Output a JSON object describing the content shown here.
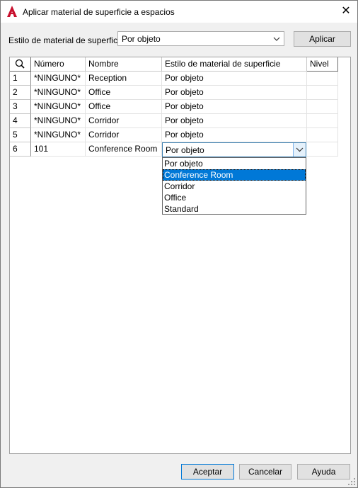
{
  "window": {
    "title": "Aplicar material de superficie a espacios",
    "close_glyph": "✕"
  },
  "style_selector": {
    "label": "Estilo de material de superficie:",
    "value": "Por objeto",
    "apply_label": "Aplicar"
  },
  "grid": {
    "headers": {
      "number": "Número",
      "name": "Nombre",
      "material_style": "Estilo de material de superficie",
      "level": "Nivel"
    },
    "rows": [
      {
        "idx": "1",
        "number": "*NINGUNO*",
        "name": "Reception",
        "style": "Por objeto",
        "level": ""
      },
      {
        "idx": "2",
        "number": "*NINGUNO*",
        "name": "Office",
        "style": "Por objeto",
        "level": ""
      },
      {
        "idx": "3",
        "number": "*NINGUNO*",
        "name": "Office",
        "style": "Por objeto",
        "level": ""
      },
      {
        "idx": "4",
        "number": "*NINGUNO*",
        "name": "Corridor",
        "style": "Por objeto",
        "level": ""
      },
      {
        "idx": "5",
        "number": "*NINGUNO*",
        "name": "Corridor",
        "style": "Por objeto",
        "level": ""
      },
      {
        "idx": "6",
        "number": "101",
        "name": "Conference Room",
        "style": "Por objeto",
        "level": ""
      }
    ],
    "editing_value": "Por objeto",
    "dropdown_options": [
      "Por objeto",
      "Conference Room",
      "Corridor",
      "Office",
      "Standard"
    ],
    "dropdown_selected": "Conference Room"
  },
  "footer": {
    "ok_label": "Aceptar",
    "cancel_label": "Cancelar",
    "help_label": "Ayuda"
  },
  "colors": {
    "accent": "#0078d7",
    "app_icon": "#c8102e"
  },
  "icons": [
    "autocad-app-icon",
    "close-icon",
    "chevron-down-icon",
    "search-icon",
    "resize-grip-icon"
  ]
}
